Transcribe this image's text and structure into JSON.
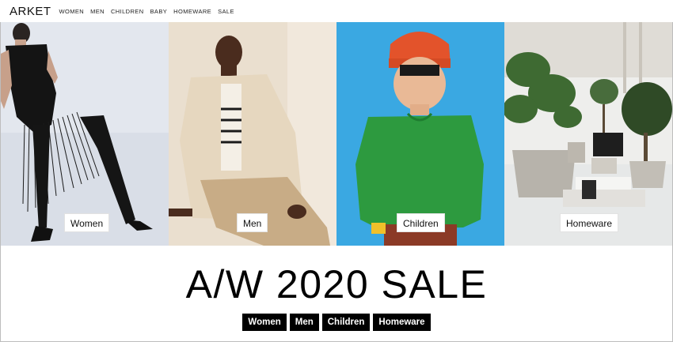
{
  "brand": {
    "name": "ARKET"
  },
  "nav": {
    "items": [
      "WOMEN",
      "MEN",
      "CHILDREN",
      "BABY",
      "HOMEWARE",
      "SALE"
    ]
  },
  "tiles": [
    {
      "label": "Women",
      "background": "#d8dde6"
    },
    {
      "label": "Men",
      "background": "#e8dccb"
    },
    {
      "label": "Children",
      "background": "#3aa6e0"
    },
    {
      "label": "Homeware",
      "background": "#ececea"
    }
  ],
  "sale": {
    "title": "A/W 2020 SALE",
    "buttons": [
      "Women",
      "Men",
      "Children",
      "Homeware"
    ]
  },
  "colors": {
    "accent": "#000000",
    "button_text": "#ffffff",
    "page_bg": "#ffffff"
  }
}
